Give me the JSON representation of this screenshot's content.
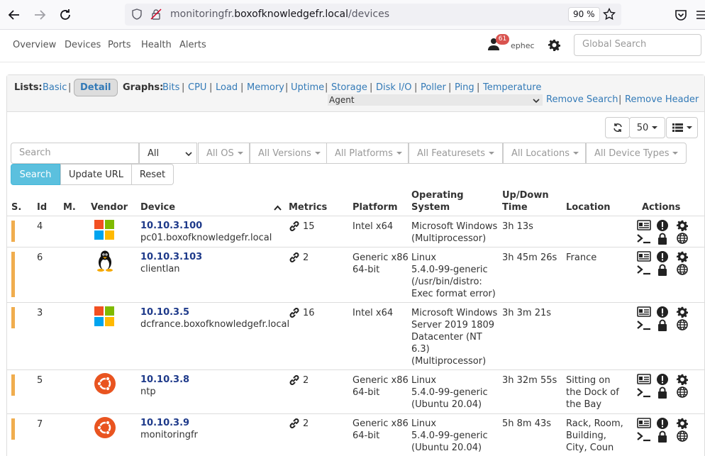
{
  "browser": {
    "url_host_prefix": "monitoringfr.",
    "url_host": "boxofknowledgefr.local",
    "url_path": "/devices",
    "zoom": "90 %"
  },
  "nav": {
    "items": [
      "Overview",
      "Devices",
      "Ports",
      "Health",
      "Alerts"
    ],
    "alert_count": "61",
    "username": "ephec",
    "global_search_placeholder": "Global Search"
  },
  "lists": {
    "label": "Lists:",
    "basic": "Basic",
    "detail": "Detail",
    "graphs_label": "Graphs:",
    "graphs": [
      "Bits",
      "CPU",
      "Load",
      "Memory",
      "Uptime",
      "Storage",
      "Disk I/O",
      "Poller",
      "Ping",
      "Temperature"
    ],
    "agent_select": "Agent",
    "remove_search": "Remove Search",
    "remove_header": "Remove Header"
  },
  "toolbar": {
    "page_size": "50"
  },
  "filters": {
    "search_placeholder": "Search",
    "status_select": "All",
    "os": "All OS",
    "versions": "All Versions",
    "platforms": "All Platforms",
    "featuresets": "All Featuresets",
    "locations": "All Locations",
    "device_types": "All Device Types",
    "search_button": "Search",
    "update_url_button": "Update URL",
    "reset_button": "Reset"
  },
  "table": {
    "headers": {
      "status": "S.",
      "id": "Id",
      "maintenance": "M.",
      "vendor": "Vendor",
      "device": "Device",
      "metrics": "Metrics",
      "platform": "Platform",
      "os": [
        "Operating",
        "System"
      ],
      "uptime": [
        "Up/Down",
        "Time"
      ],
      "location": "Location",
      "actions": "Actions"
    },
    "rows": [
      {
        "id": "4",
        "vendor": "windows",
        "ip": "10.10.3.100",
        "host": "pc01.boxofknowledgefr.local",
        "metrics": "15",
        "platform": [
          "Intel x64"
        ],
        "os": [
          "Microsoft Windows",
          "(Multiprocessor)"
        ],
        "uptime": "3h 13s",
        "location": []
      },
      {
        "id": "6",
        "vendor": "linux",
        "ip": "10.10.3.103",
        "host": "clientlan",
        "metrics": "2",
        "platform": [
          "Generic x86",
          "64-bit"
        ],
        "os": [
          "Linux",
          "5.4.0-99-generic",
          "(/usr/bin/distro:",
          "Exec format error)"
        ],
        "uptime": "3h 45m 26s",
        "location": [
          "France"
        ]
      },
      {
        "id": "3",
        "vendor": "windows",
        "ip": "10.10.3.5",
        "host": "dcfrance.boxofknowledgefr.local",
        "metrics": "16",
        "platform": [
          "Intel x64"
        ],
        "os": [
          "Microsoft Windows",
          "Server 2019 1809",
          "Datacenter (NT",
          "6.3)",
          "(Multiprocessor)"
        ],
        "uptime": "3h 3m 21s",
        "location": []
      },
      {
        "id": "5",
        "vendor": "ubuntu",
        "ip": "10.10.3.8",
        "host": "ntp",
        "metrics": "2",
        "platform": [
          "Generic x86",
          "64-bit"
        ],
        "os": [
          "Linux",
          "5.4.0-99-generic",
          "(Ubuntu 20.04)"
        ],
        "uptime": "3h 32m 55s",
        "location": [
          "Sitting on",
          "the Dock of",
          "the Bay"
        ]
      },
      {
        "id": "7",
        "vendor": "ubuntu",
        "ip": "10.10.3.9",
        "host": "monitoringfr",
        "metrics": "2",
        "platform": [
          "Generic x86",
          "64-bit"
        ],
        "os": [
          "Linux",
          "5.4.0-99-generic",
          "(Ubuntu 20.04)"
        ],
        "uptime": "5h 8m 43s",
        "location": [
          "Rack, Room,",
          "Building,",
          "City, Coun"
        ]
      }
    ]
  },
  "colors": {
    "link": "#337ab7",
    "device_link": "#1e3a8a",
    "status_warning": "#f0ad4e",
    "primary_button": "#5bc0de",
    "badge": "#d9534f"
  }
}
